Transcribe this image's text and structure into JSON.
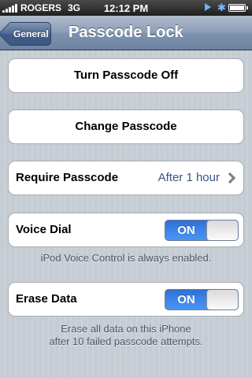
{
  "status_bar": {
    "carrier": "ROGERS",
    "network": "3G",
    "time": "12:12 PM",
    "icons": [
      "signal-icon",
      "play-icon",
      "bluetooth-icon",
      "battery-icon"
    ]
  },
  "nav": {
    "back_label": "General",
    "title": "Passcode Lock"
  },
  "cells": {
    "turn_off_label": "Turn Passcode Off",
    "change_label": "Change Passcode",
    "require_label": "Require Passcode",
    "require_value": "After 1 hour",
    "voice_dial_label": "Voice Dial",
    "voice_dial_state": "ON",
    "voice_footer": "iPod Voice Control is always enabled.",
    "erase_label": "Erase Data",
    "erase_state": "ON",
    "erase_footer_line1": "Erase all data on this iPhone",
    "erase_footer_line2": "after 10 failed passcode attempts."
  },
  "colors": {
    "nav_tint": "#6d83a2",
    "toggle_on": "#3c85ea",
    "value_text": "#385487",
    "group_background": "#c5ccd4"
  }
}
